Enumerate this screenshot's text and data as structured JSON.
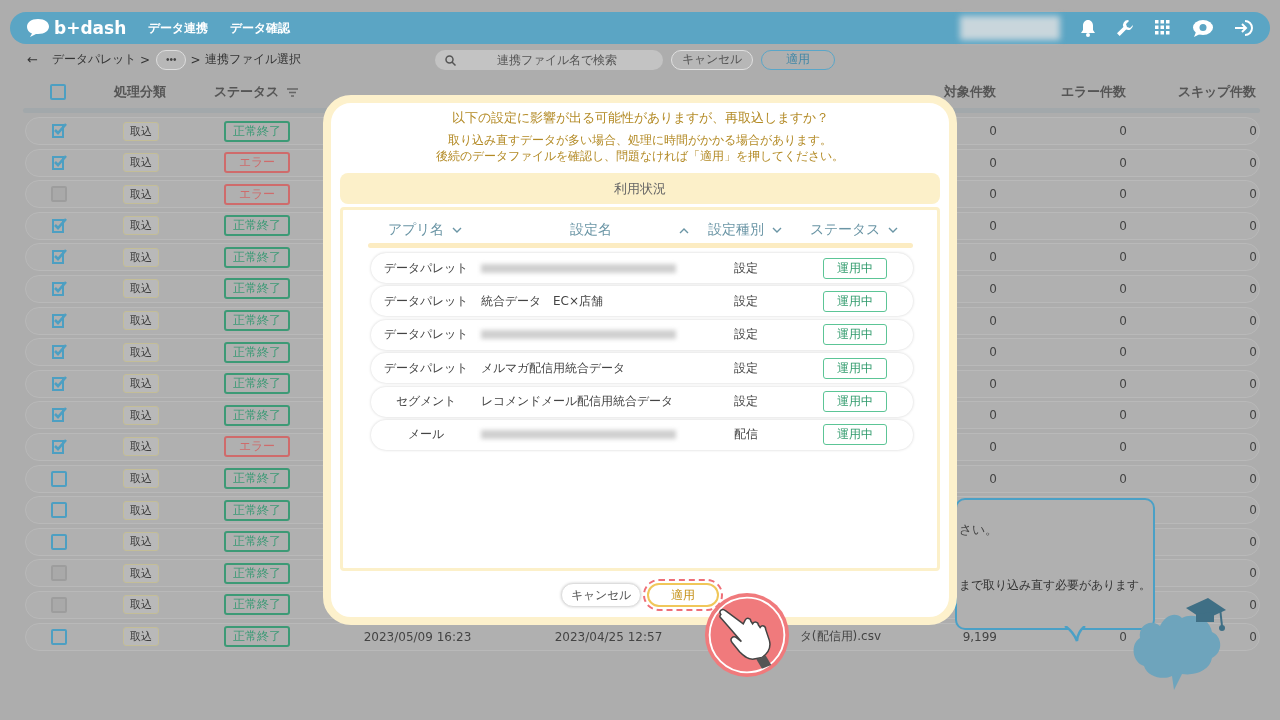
{
  "header": {
    "logo": "b+dash",
    "nav": [
      {
        "label": "データ連携"
      },
      {
        "label": "データ確認"
      }
    ]
  },
  "toolbar": {
    "back": "←",
    "breadcrumb": [
      {
        "label": "データパレット",
        "kind": "link"
      },
      {
        "label": ">",
        "kind": "separator"
      },
      {
        "label": "•••",
        "kind": "more"
      },
      {
        "label": ">",
        "kind": "separator"
      },
      {
        "label": "連携ファイル選択",
        "kind": "current"
      }
    ],
    "search": {
      "placeholder": "連携ファイル名で検索"
    },
    "buttons": [
      {
        "label": "キャンセル",
        "kind": "secondary"
      },
      {
        "label": "適用",
        "kind": "primary"
      }
    ]
  },
  "table": {
    "select_all": {
      "checked": false
    },
    "columns": [
      {
        "label": "処理分類"
      },
      {
        "label": "ステータス"
      },
      {
        "label": "対象件数"
      },
      {
        "label": "エラー件数"
      },
      {
        "label": "スキップ件数"
      }
    ],
    "rows": [
      {
        "checked": true,
        "disabled": false,
        "category": "取込",
        "status": "正常終了",
        "kind": "success",
        "target": "0",
        "errors": "0",
        "skipped": "0"
      },
      {
        "checked": true,
        "disabled": false,
        "category": "取込",
        "status": "エラー",
        "kind": "error",
        "target": "0",
        "errors": "0",
        "skipped": "0"
      },
      {
        "checked": false,
        "disabled": true,
        "category": "取込",
        "status": "エラー",
        "kind": "error",
        "target": "0",
        "errors": "0",
        "skipped": "0"
      },
      {
        "checked": true,
        "disabled": false,
        "category": "取込",
        "status": "正常終了",
        "kind": "success",
        "target": "0",
        "errors": "0",
        "skipped": "0"
      },
      {
        "checked": true,
        "disabled": false,
        "category": "取込",
        "status": "正常終了",
        "kind": "success",
        "target": "0",
        "errors": "0",
        "skipped": "0"
      },
      {
        "checked": true,
        "disabled": false,
        "category": "取込",
        "status": "正常終了",
        "kind": "success",
        "target": "0",
        "errors": "0",
        "skipped": "0"
      },
      {
        "checked": true,
        "disabled": false,
        "category": "取込",
        "status": "正常終了",
        "kind": "success",
        "target": "0",
        "errors": "0",
        "skipped": "0"
      },
      {
        "checked": true,
        "disabled": false,
        "category": "取込",
        "status": "正常終了",
        "kind": "success",
        "target": "0",
        "errors": "0",
        "skipped": "0"
      },
      {
        "checked": true,
        "disabled": false,
        "category": "取込",
        "status": "正常終了",
        "kind": "success",
        "target": "0",
        "errors": "0",
        "skipped": "0"
      },
      {
        "checked": true,
        "disabled": false,
        "category": "取込",
        "status": "正常終了",
        "kind": "success",
        "target": "0",
        "errors": "0",
        "skipped": "0"
      },
      {
        "checked": true,
        "disabled": false,
        "category": "取込",
        "status": "エラー",
        "kind": "error",
        "target": "0",
        "errors": "0",
        "skipped": "0"
      },
      {
        "checked": false,
        "disabled": false,
        "category": "取込",
        "status": "正常終了",
        "kind": "success",
        "target": "0",
        "errors": "0",
        "skipped": "0"
      },
      {
        "checked": false,
        "disabled": false,
        "category": "取込",
        "status": "正常終了",
        "kind": "success",
        "skipped": "0"
      },
      {
        "checked": false,
        "disabled": false,
        "category": "取込",
        "status": "正常終了",
        "kind": "success",
        "skipped": "0"
      },
      {
        "checked": false,
        "disabled": true,
        "category": "取込",
        "status": "正常終了",
        "kind": "success",
        "skipped": "0"
      },
      {
        "checked": false,
        "disabled": true,
        "category": "取込",
        "status": "正常終了",
        "kind": "success",
        "skipped": "0"
      },
      {
        "checked": false,
        "disabled": false,
        "category": "取込",
        "status": "正常終了",
        "kind": "success",
        "start": "2023/05/09 16:23",
        "end": "2023/04/25 12:57",
        "file": "タ(配信用).csv",
        "target": "9,199",
        "errors": "0",
        "skipped": "0"
      }
    ]
  },
  "modal": {
    "title": "以下の設定に影響が出る可能性がありますが、再取込しますか？",
    "notes": [
      "取り込み直すデータが多い場合、処理に時間がかかる場合があります。",
      "後続のデータファイルを確認し、問題なければ「適用」を押してください。"
    ],
    "section": "利用状況",
    "columns": [
      {
        "label": "アプリ名",
        "ascending": false
      },
      {
        "label": "設定名",
        "ascending": true
      },
      {
        "label": "設定種別",
        "ascending": false
      },
      {
        "label": "ステータス",
        "ascending": false
      }
    ],
    "rows": [
      {
        "app": "データパレット",
        "redacted": true,
        "type": "設定",
        "status": "運用中"
      },
      {
        "app": "データパレット",
        "name": "統合データ　EC×店舗",
        "type": "設定",
        "status": "運用中"
      },
      {
        "app": "データパレット",
        "redacted": true,
        "type": "設定",
        "status": "運用中"
      },
      {
        "app": "データパレット",
        "name": "メルマガ配信用統合データ",
        "type": "設定",
        "status": "運用中"
      },
      {
        "app": "セグメント",
        "name": "レコメンドメール配信用統合データ",
        "type": "設定",
        "status": "運用中"
      },
      {
        "app": "メール",
        "redacted": true,
        "type": "配信",
        "status": "運用中"
      }
    ],
    "buttons": [
      {
        "label": "キャンセル",
        "kind": "secondary",
        "highlighted": false
      },
      {
        "label": "適用",
        "kind": "primary",
        "highlighted": true
      }
    ]
  },
  "bubble": {
    "lines": [
      "さい。",
      "まで取り込み直す必要があります。"
    ]
  }
}
